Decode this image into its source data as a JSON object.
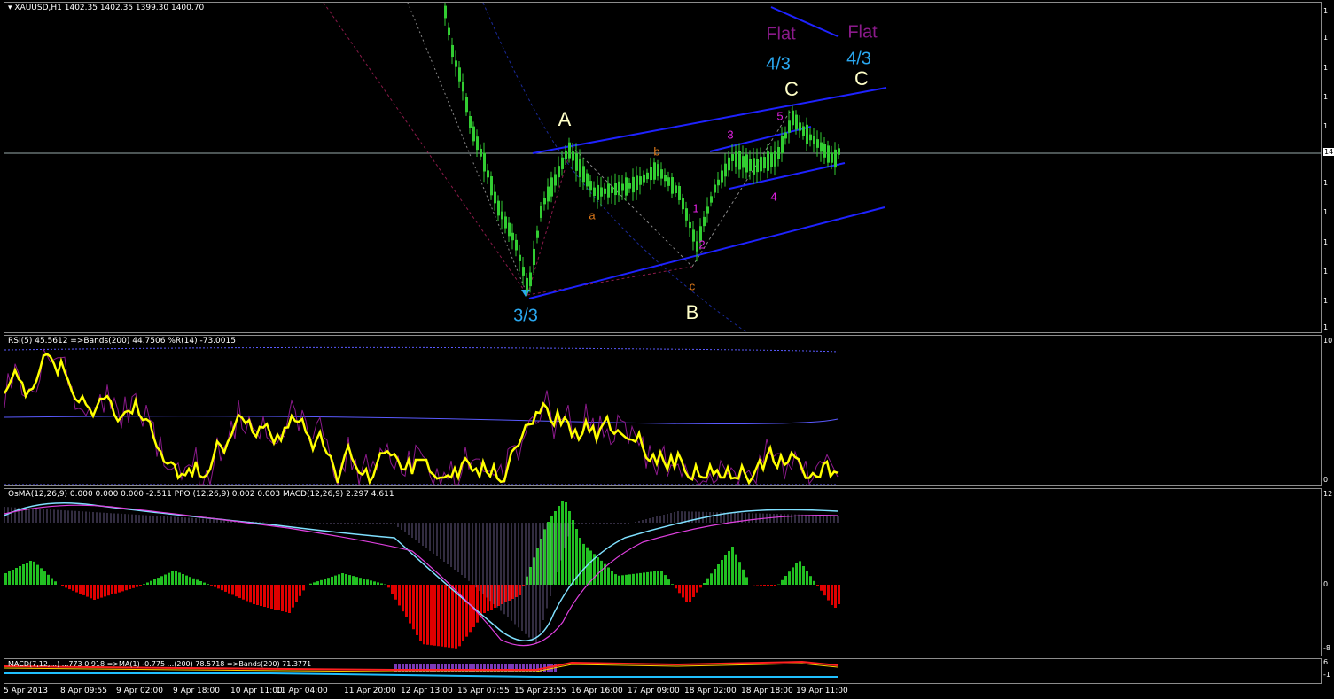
{
  "main": {
    "title": "XAUUSD,H1  1402.35 1402.35 1399.30 1400.70",
    "labels": {
      "wave_A": "A",
      "wave_B": "B",
      "wave_C": "C",
      "wave_C2": "C",
      "flat1": "Flat",
      "flat2": "Flat",
      "fraction_33": "3/3",
      "fraction_43a": "4/3",
      "fraction_43b": "4/3",
      "sub_a": "a",
      "sub_b": "b",
      "sub_c": "c",
      "imp_1": "1",
      "imp_2": "2",
      "imp_3": "3",
      "imp_4": "4",
      "imp_5": "5"
    },
    "price_marker": "14"
  },
  "rsi": {
    "title": "RSI(5) 45.5612  =>Bands(200) 44.7506  %R(14) -73.0015",
    "scale_top": "10",
    "scale_bottom": "0"
  },
  "osma": {
    "title": "OsMA(12,26,9) 0.000 0.000 0.000 -2.511  PPO (12,26,9) 0.002 0.003  MACD(12,26,9) 2.297 4.611",
    "scale_top": "12",
    "scale_mid": "0.",
    "scale_bottom": "-8"
  },
  "macd2": {
    "title": "MACD(7,12,...)  ...773  0.918  =>MA(1) -0.775  ...(200)  78.5718  =>Bands(200)  71.3771",
    "scale_top": "6.",
    "scale_bottom": "-1"
  },
  "xaxis": [
    "5 Apr 2013",
    "8 Apr 09:55",
    "9 Apr 02:00",
    "9 Apr 18:00",
    "10 Apr 11:00",
    "11 Apr 04:00",
    "11 Apr 20:00",
    "12 Apr 13:00",
    "15 Apr 07:55",
    "15 Apr 23:55",
    "16 Apr 16:00",
    "17 Apr 09:00",
    "18 Apr 02:00",
    "18 Apr 18:00",
    "19 Apr 11:00"
  ],
  "colors": {
    "candle": "#32cd32",
    "channel": "#1e22ff",
    "rsi": "#ffff00",
    "hist_up": "#22c022",
    "hist_down": "#e00000",
    "wave_white": "#ffffc8",
    "wave_purple": "#8b1a8b",
    "wave_cyan": "#2aa8f0",
    "wave_orange": "#e07a1a",
    "wave_magenta": "#e020e0"
  }
}
